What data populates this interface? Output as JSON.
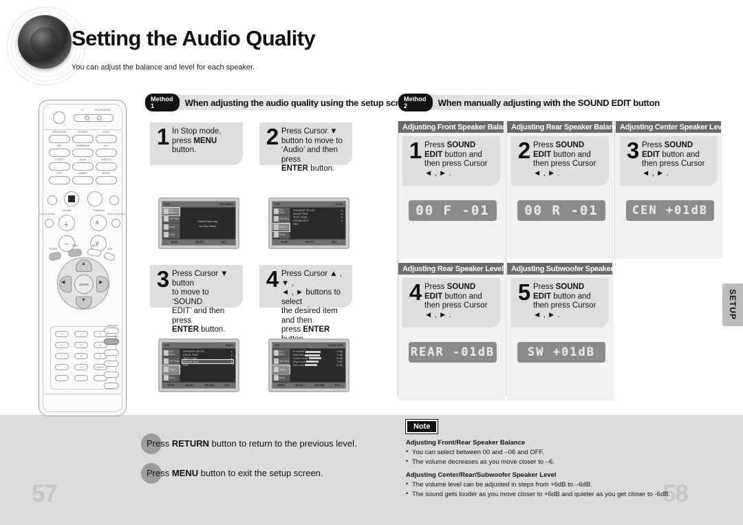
{
  "page": {
    "title": "Setting the Audio Quality",
    "subtitle": "You can adjust the balance and level for each speaker.",
    "page_left": "57",
    "page_right": "58",
    "side_tab": "SETUP"
  },
  "method1": {
    "tag": "Method 1",
    "heading": "When adjusting the audio quality using the setup screen",
    "steps": [
      {
        "num": "1",
        "text_html": "In Stop mode,<br>press <b>MENU</b><br>button."
      },
      {
        "num": "2",
        "text_html": "Press Cursor ▼<br>button to move to<br>‘Audio’ and then press<br><b>ENTER</b> button."
      },
      {
        "num": "3",
        "text_html": "Press Cursor ▼ button<br>to move to ‘SOUND<br>EDIT’ and then press<br><b>ENTER</b> button."
      },
      {
        "num": "4",
        "text_html": "Press Cursor ▲ , ▼ ,<br>◄ , ► buttons to select<br>the desired item and then<br>press <b>ENTER</b> button."
      }
    ],
    "screens": [
      {
        "id": "screen-1",
        "top_left": "DVD",
        "top_right": "DISC MENU",
        "sidebar": [
          "Disc Menu",
          "Title Menu",
          "Audio",
          "Setup"
        ],
        "selected_sidebar": 0,
        "center_lines": [
          "Press Enter key",
          "for Disc Menu"
        ],
        "bottom": [
          "MOVE",
          "SELECT",
          "EXIT"
        ]
      },
      {
        "id": "screen-2",
        "top_left": "DVD",
        "top_right": "AUDIO",
        "sidebar": [
          "Disc Menu",
          "Title Menu",
          "Audio",
          "Setup"
        ],
        "selected_sidebar": 2,
        "rows": [
          {
            "label": "SPEAKER SETUP",
            "value": ""
          },
          {
            "label": "DELAY TIME",
            "value": ""
          },
          {
            "label": "TEST TONE",
            "value": ""
          },
          {
            "label": "SOUND EDIT",
            "value": ""
          },
          {
            "label": "DRC",
            "value": ":"
          }
        ],
        "highlight_row": -1,
        "bottom": [
          "MOVE",
          "SELECT",
          "EXIT"
        ]
      },
      {
        "id": "screen-3",
        "top_left": "DVD",
        "top_right": "AUDIO",
        "sidebar": [
          "Disc Menu",
          "Title Menu",
          "Audio",
          "Setup"
        ],
        "selected_sidebar": 2,
        "rows": [
          {
            "label": "SPEAKER SETUP",
            "value": ""
          },
          {
            "label": "DELAY TIME",
            "value": ""
          },
          {
            "label": "TEST TONE",
            "value": ""
          },
          {
            "label": "SOUND EDIT",
            "value": ""
          },
          {
            "label": "DRC",
            "value": ":"
          }
        ],
        "highlight_row": 3,
        "bottom": [
          "MOVE",
          "SELECT",
          "RETURN",
          "EXIT"
        ]
      },
      {
        "id": "screen-4",
        "top_left": "DVD",
        "top_right": "SOUND EDIT",
        "sidebar": [
          "Disc Menu",
          "Title Menu",
          "Audio",
          "Setup"
        ],
        "selected_sidebar": 2,
        "edit_rows": [
          {
            "label": "Front BAL",
            "value": "0 dB"
          },
          {
            "label": "Rear BAL",
            "value": "0 dB"
          },
          {
            "label": "Center Level",
            "value": "+0 dB"
          },
          {
            "label": "Rear Level",
            "value": "0 dB"
          },
          {
            "label": "SW Level",
            "value": "+0 dB"
          }
        ],
        "bottom": [
          "MOVE",
          "SELECT",
          "RETURN",
          "EXIT"
        ]
      }
    ]
  },
  "method2": {
    "tag": "Method 2",
    "heading": "When manually adjusting with the SOUND EDIT button",
    "panels": [
      {
        "head": "Adjusting Front Speaker Balance",
        "num": "1",
        "text_html": "Press <b>SOUND</b><br><b>EDIT</b> button and<br>then press Cursor<br>◄ , ► .",
        "lcd": "00 F -01"
      },
      {
        "head": "Adjusting Rear Speaker Balance",
        "num": "2",
        "text_html": "Press <b>SOUND</b><br><b>EDIT</b> button and<br>then press Cursor<br>◄ , ► .",
        "lcd": "00 R -01"
      },
      {
        "head": "Adjusting Center Speaker Level",
        "num": "3",
        "text_html": "Press <b>SOUND</b><br><b>EDIT</b> button and<br>then press Cursor<br>◄ , ► .",
        "lcd": "CEN +01dB"
      },
      {
        "head": "Adjusting Rear Speaker Level",
        "num": "4",
        "text_html": "Press <b>SOUND</b><br><b>EDIT</b> button and<br>then press Cursor<br>◄ , ► .",
        "lcd": "REAR -01dB"
      },
      {
        "head": "Adjusting Subwoofer Speaker Level",
        "num": "5",
        "text_html": "Press <b>SOUND</b><br><b>EDIT</b> button and<br>then press Cursor<br>◄ , ► .",
        "lcd": "SW  +01dB"
      }
    ]
  },
  "tips": [
    {
      "html": "Press <b>RETURN</b> button to return to the previous level."
    },
    {
      "html": "Press <b>MENU</b> button to exit the setup screen."
    }
  ],
  "note": {
    "tag": "Note",
    "sections": [
      {
        "heading": "Adjusting Front/Rear Speaker Balance",
        "items": [
          "You can select between 00 and –06 and OFF.",
          "The volume decreases as you move closer to –6."
        ]
      },
      {
        "heading": "Adjusting Center/Rear/Subwoofer Speaker Level",
        "items": [
          "The volume level can be adjusted in steps from +6dB to –6dB.",
          "The sound gets louder as you move closer to +6dB and quieter as you get closer to -6dB."
        ]
      }
    ]
  },
  "remote": {
    "power_label": "",
    "toggle_labels": [
      "TV",
      "DVD RECEIVER"
    ],
    "rows": [
      [
        "OPEN/CLOSE",
        "TV/VIDEO",
        "MODE"
      ],
      [
        "DVD",
        "TUNER/BAND",
        "AUX"
      ],
      [
        "TV MUTE",
        "SLOW",
        "SUBTITLE"
      ],
      [
        "STEP",
        "DIMMER",
        "REPEAT"
      ]
    ],
    "volume_label": "VOLUME",
    "tuning_label": "TUNING/CH",
    "left_label": "DOLBY PL II MODE",
    "right_label": "DOLBY PL II EFFECT",
    "menu_label": "MENU",
    "return_label": "RETURN",
    "info_label": "INFO",
    "exit_label": "EXIT",
    "enter_label": "ENTER",
    "keypad": [
      [
        "1",
        "2",
        "3"
      ],
      [
        "4",
        "5",
        "6"
      ],
      [
        "7",
        "8",
        "9"
      ],
      [
        "",
        "0",
        "CANCEL"
      ],
      [
        "LOGO",
        "MUTE/MODE",
        "DISPLAY"
      ]
    ],
    "side_keys": [
      "TEST TONE",
      "SOUND EDIT",
      "SOUND MODE",
      "P.SCAN",
      "ZOOM",
      "REMAIN"
    ],
    "highlight_key": "SOUND EDIT"
  },
  "colors": {
    "footer": "#dcdcdc",
    "step_bg": "#dedede",
    "section_head": "#6a6a6a",
    "lcd_bg": "#8a8a8a",
    "tag_black": "#111111",
    "page_num": "#c6c6c6"
  }
}
